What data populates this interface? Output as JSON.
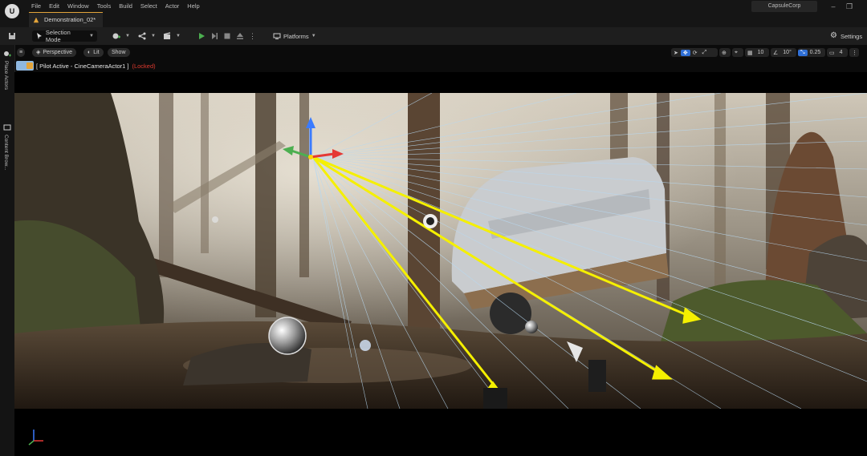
{
  "menu": {
    "items": [
      "File",
      "Edit",
      "Window",
      "Tools",
      "Build",
      "Select",
      "Actor",
      "Help"
    ]
  },
  "document_tab": {
    "label": "Demonstration_02*"
  },
  "project_name": "CapsuleCorp",
  "toolbar": {
    "selection_mode": "Selection Mode",
    "platforms": "Platforms",
    "settings": "Settings"
  },
  "side_panel": {
    "place_actors": "Place Actors",
    "content_browser": "Content Brow..."
  },
  "viewport_toolbar": {
    "perspective": "Perspective",
    "lit": "Lit",
    "show": "Show",
    "grid_snap": "10",
    "rotation_snap": "10°",
    "scale_snap": "0.25",
    "camera_speed": "4"
  },
  "pilot": {
    "text": "[ Pilot Active - CineCameraActor1 ]",
    "locked": "(Locked)"
  },
  "icons": [
    "unreal-logo",
    "save-icon",
    "add-actor-icon",
    "blueprint-icon",
    "cinematics-icon",
    "play-icon",
    "step-icon",
    "stop-icon",
    "eject-icon",
    "more-icon",
    "platforms-icon",
    "settings-icon",
    "hamburger-icon",
    "camera-icon",
    "select-icon",
    "translate-icon",
    "rotate-icon",
    "scale-icon",
    "world-icon",
    "grid-icon",
    "angle-icon",
    "scale-snap-icon",
    "camera-speed-icon",
    "maximize-icon",
    "axis-gizmo-icon"
  ],
  "colors": {
    "accent": "#e3a43a",
    "locked": "#e03a2f",
    "play": "#4caf50",
    "highlight": "#2f6fd6",
    "debug_lines": "#f5f000"
  }
}
